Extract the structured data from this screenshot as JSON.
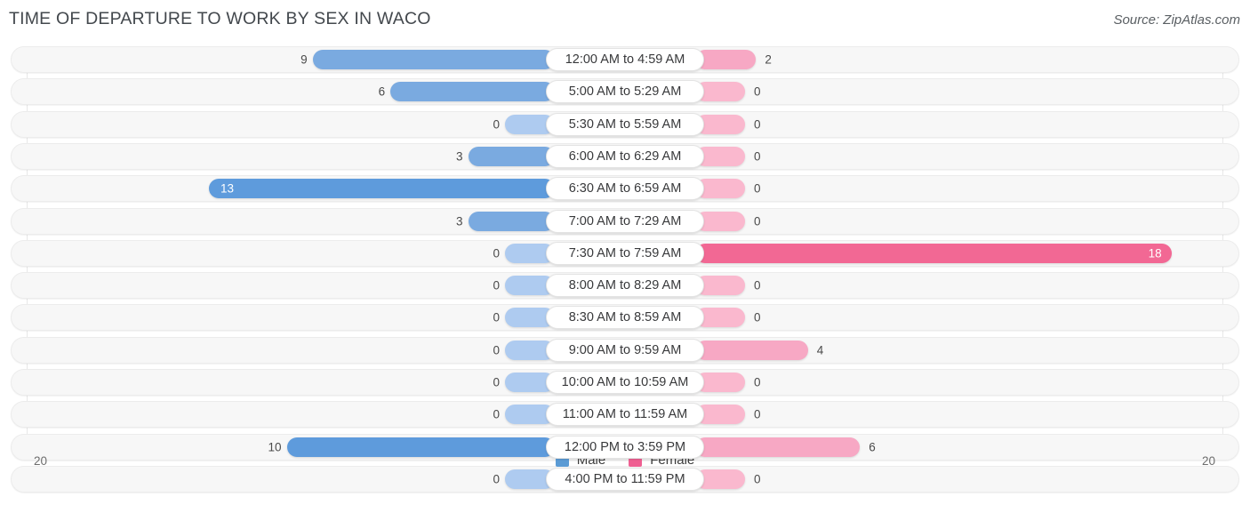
{
  "header": {
    "title": "TIME OF DEPARTURE TO WORK BY SEX IN WACO",
    "source": "Source: ZipAtlas.com"
  },
  "axis": {
    "left_label": "20",
    "right_label": "20"
  },
  "legend": {
    "items": [
      {
        "label": "Male",
        "color": "#5b9bd5"
      },
      {
        "label": "Female",
        "color": "#ef5f92"
      }
    ]
  },
  "colors": {
    "male_strong": "#5e9bdc",
    "male_mid": "#7aaae0",
    "male_zero": "#aecbf0",
    "female_strong": "#f26894",
    "female_mid": "#f7a8c4",
    "female_zero": "#fab8ce",
    "track": "#f7f7f7",
    "gridline": "#e8e8e8"
  },
  "chart_data": {
    "type": "bar",
    "subtype": "diverging-bidirectional",
    "title": "TIME OF DEPARTURE TO WORK BY SEX IN WACO",
    "xlabel": "",
    "ylabel": "",
    "xlim": [
      20,
      20
    ],
    "axis_left_max": 20,
    "axis_right_max": 20,
    "grid": true,
    "legend_position": "bottom-center",
    "categories": [
      "12:00 AM to 4:59 AM",
      "5:00 AM to 5:29 AM",
      "5:30 AM to 5:59 AM",
      "6:00 AM to 6:29 AM",
      "6:30 AM to 6:59 AM",
      "7:00 AM to 7:29 AM",
      "7:30 AM to 7:59 AM",
      "8:00 AM to 8:29 AM",
      "8:30 AM to 8:59 AM",
      "9:00 AM to 9:59 AM",
      "10:00 AM to 10:59 AM",
      "11:00 AM to 11:59 AM",
      "12:00 PM to 3:59 PM",
      "4:00 PM to 11:59 PM"
    ],
    "series": [
      {
        "name": "Male",
        "direction": "left",
        "values": [
          9,
          6,
          0,
          3,
          13,
          3,
          0,
          0,
          0,
          0,
          0,
          0,
          10,
          0
        ]
      },
      {
        "name": "Female",
        "direction": "right",
        "values": [
          2,
          0,
          0,
          0,
          0,
          0,
          18,
          0,
          0,
          4,
          0,
          0,
          6,
          0
        ]
      }
    ]
  }
}
